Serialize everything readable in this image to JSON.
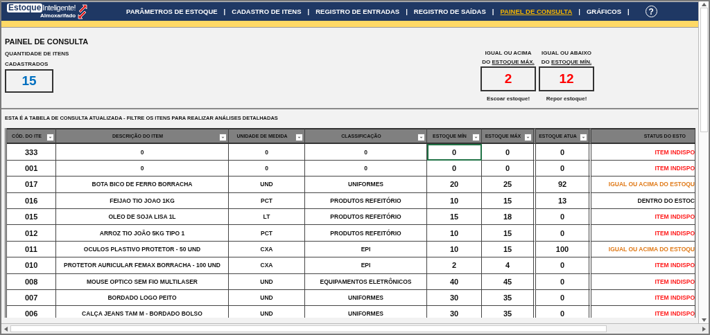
{
  "logo": {
    "word_1": "Estoque",
    "word_2": "Inteligente!",
    "subtitle": "Almoxarifado"
  },
  "nav": [
    {
      "label": "PARÂMETROS DE ESTOQUE",
      "selected": false,
      "separator": "|"
    },
    {
      "label": "CADASTRO DE ITENS",
      "selected": false,
      "separator": "|"
    },
    {
      "label": "REGISTRO DE ENTRADAS",
      "selected": false,
      "separator": "|"
    },
    {
      "label": "REGISTRO DE SAÍDAS",
      "selected": false,
      "separator": "|"
    },
    {
      "label": "PAINEL DE CONSULTA",
      "selected": true,
      "separator": "|"
    },
    {
      "label": "GRÁFICOS",
      "selected": false,
      "separator": "|"
    }
  ],
  "help": "?",
  "title": "PAINEL DE CONSULTA",
  "total": {
    "label_1": "QUANTIDADE DE ITENS",
    "label_2": "CADASTRADOS",
    "value": "15"
  },
  "alerts": [
    {
      "label_1": "IGUAL OU ACIMA",
      "label_2": "DO",
      "label_underlined": "ESTOQUE MÁX.",
      "value": "2",
      "caption": "Escoar estoque!"
    },
    {
      "label_1": "IGUAL OU ABAIXO",
      "label_2": "DO",
      "label_underlined": "ESTOQUE MÍN.",
      "value": "12",
      "caption": "Repor estoque!"
    }
  ],
  "table_caption": "ESTA É A TABELA DE CONSULTA ATUALIZADA - FILTRE OS ITENS PARA REALIZAR ANÁLISES DETALHADAS",
  "table": {
    "columns": [
      "CÓD. DO ITE",
      "DESCRIÇÃO DO ITEM",
      "UNIDADE DE MEDIDA",
      "CLASSIFICAÇÃO",
      "ESTOQUE MÍN",
      "ESTOQUE MÁX",
      "ESTOQUE ATUA",
      "STATUS DO ESTO"
    ],
    "rows": [
      {
        "code": "333",
        "description": "0",
        "unit": "0",
        "category": "0",
        "min": "0",
        "max": "0",
        "current": "0",
        "status": "ITEM INDISPO",
        "kind": "unavailable"
      },
      {
        "code": "001",
        "description": "0",
        "unit": "0",
        "category": "0",
        "min": "0",
        "max": "0",
        "current": "0",
        "status": "ITEM INDISPO",
        "kind": "unavailable"
      },
      {
        "code": "017",
        "description": "BOTA BICO DE FERRO BORRACHA",
        "unit": "UND",
        "category": "UNIFORMES",
        "min": "20",
        "max": "25",
        "current": "92",
        "status": "IGUAL OU ACIMA DO ESTOQU",
        "kind": "above"
      },
      {
        "code": "016",
        "description": "FEIJAO TIO JOAO 1KG",
        "unit": "PCT",
        "category": "PRODUTOS REFEITÓRIO",
        "min": "10",
        "max": "15",
        "current": "13",
        "status": "DENTRO DO ESTOC",
        "kind": "within"
      },
      {
        "code": "015",
        "description": "OLEO DE SOJA LISA 1L",
        "unit": "LT",
        "category": "PRODUTOS REFEITÓRIO",
        "min": "15",
        "max": "18",
        "current": "0",
        "status": "ITEM INDISPO",
        "kind": "unavailable"
      },
      {
        "code": "012",
        "description": "ARROZ TIO JOÃO 5KG TIPO 1",
        "unit": "PCT",
        "category": "PRODUTOS REFEITÓRIO",
        "min": "10",
        "max": "15",
        "current": "0",
        "status": "ITEM INDISPO",
        "kind": "unavailable"
      },
      {
        "code": "011",
        "description": "OCULOS PLASTIVO PROTETOR - 50 UND",
        "unit": "CXA",
        "category": "EPI",
        "min": "10",
        "max": "15",
        "current": "100",
        "status": "IGUAL OU ACIMA DO ESTOQU",
        "kind": "above"
      },
      {
        "code": "010",
        "description": "PROTETOR AURICULAR FEMAX BORRACHA - 100 UND",
        "unit": "CXA",
        "category": "EPI",
        "min": "2",
        "max": "4",
        "current": "0",
        "status": "ITEM INDISPO",
        "kind": "unavailable"
      },
      {
        "code": "008",
        "description": "MOUSE OPTICO SEM FIO MULTILASER",
        "unit": "UND",
        "category": "EQUIPAMENTOS ELETRÔNICOS",
        "min": "40",
        "max": "45",
        "current": "0",
        "status": "ITEM INDISPO",
        "kind": "unavailable"
      },
      {
        "code": "007",
        "description": "BORDADO LOGO PEITO",
        "unit": "UND",
        "category": "UNIFORMES",
        "min": "30",
        "max": "35",
        "current": "0",
        "status": "ITEM INDISPO",
        "kind": "unavailable"
      },
      {
        "code": "006",
        "description": "CALÇA JEANS TAM M - BORDADO BOLSO",
        "unit": "UND",
        "category": "UNIFORMES",
        "min": "30",
        "max": "35",
        "current": "0",
        "status": "ITEM INDISPO",
        "kind": "unavailable"
      }
    ]
  }
}
